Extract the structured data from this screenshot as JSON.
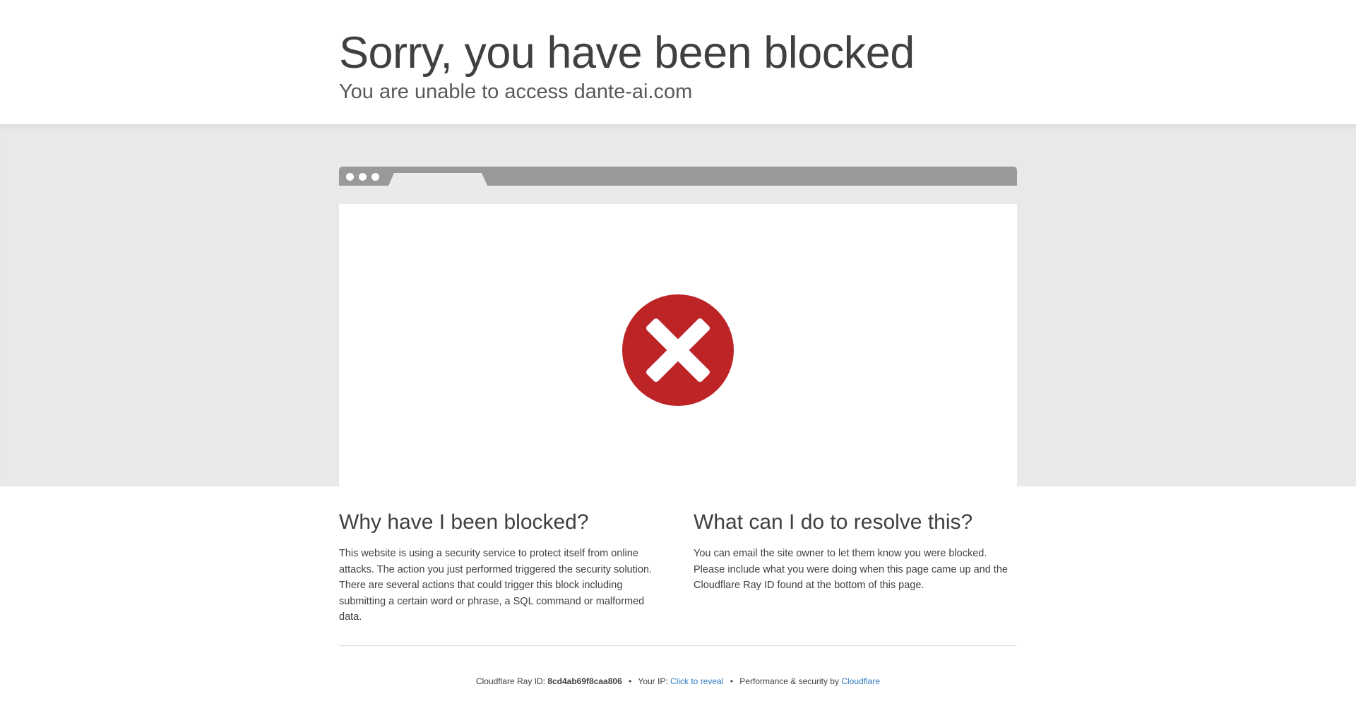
{
  "header": {
    "title": "Sorry, you have been blocked",
    "subtitle": "You are unable to access dante-ai.com"
  },
  "colors": {
    "error_red": "#bd2426",
    "link_blue": "#2f7bbf",
    "band_gray": "#e9e9e9",
    "browser_bar": "#999999"
  },
  "illustration": {
    "icon": "x-circle-icon"
  },
  "why": {
    "heading": "Why have I been blocked?",
    "body": "This website is using a security service to protect itself from online attacks. The action you just performed triggered the security solution. There are several actions that could trigger this block including submitting a certain word or phrase, a SQL command or malformed data."
  },
  "resolve": {
    "heading": "What can I do to resolve this?",
    "body": "You can email the site owner to let them know you were blocked. Please include what you were doing when this page came up and the Cloudflare Ray ID found at the bottom of this page."
  },
  "footer": {
    "ray_label": "Cloudflare Ray ID: ",
    "ray_id": "8cd4ab69f8caa806",
    "separator": "•",
    "ip_label": "Your IP: ",
    "ip_link": "Click to reveal",
    "perf_label": "Performance & security by ",
    "cf_link": "Cloudflare"
  }
}
